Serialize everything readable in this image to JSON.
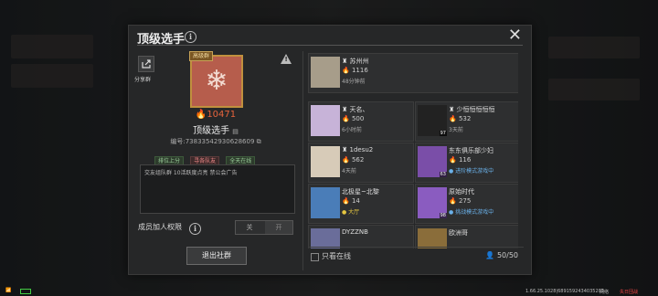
{
  "dialog": {
    "title": "顶级选手",
    "share_label": "分享群",
    "group_tag": "高级群",
    "power": "10471",
    "group_name": "顶级选手",
    "group_id": "编号:73833542930628609",
    "chips": [
      "排位上分",
      "寻各队友",
      "全天在线"
    ],
    "description": "交友组队群 10活跃度点亮 禁公会广告",
    "permission_label": "成员加人权限",
    "toggle_off": "关",
    "toggle_on": "开",
    "exit_label": "退出社群",
    "online_only_label": "只看在线",
    "member_count": "50/50"
  },
  "members": [
    {
      "name": "苏州州",
      "power": "1116",
      "status": "48分钟前",
      "status_color": "grey",
      "avatar_color": "#a79d8a"
    },
    {
      "name": "天名、",
      "power": "500",
      "status": "6小时前",
      "status_color": "grey",
      "avatar_color": "#c7b3d8"
    },
    {
      "name": "少恒恒恒恒恒",
      "power": "532",
      "status": "3天前",
      "status_color": "grey",
      "avatar_color": "#222222",
      "level": "97"
    },
    {
      "name": "1desu2",
      "power": "562",
      "status": "4天前",
      "status_color": "grey",
      "avatar_color": "#d7cbb8"
    },
    {
      "name": "东东俱乐部少妇",
      "power": "116",
      "status": "进阶模式游戏中",
      "status_color": "blue",
      "avatar_color": "#7a4ea8",
      "level": "63"
    },
    {
      "name": "北极星~北黎",
      "power": "14",
      "status": "大厅",
      "status_color": "yellow",
      "avatar_color": "#4a7db8"
    },
    {
      "name": "原始时代",
      "power": "275",
      "status": "挑战模式游戏中",
      "status_color": "blue",
      "avatar_color": "#8a5cc0",
      "level": "98"
    },
    {
      "name": "DYZZNB",
      "power": "",
      "status": "",
      "status_color": "grey",
      "avatar_color": "#6a6d9a"
    },
    {
      "name": "欧洲哥",
      "power": "",
      "status": "",
      "status_color": "grey",
      "avatar_color": "#8a6d3a"
    }
  ],
  "statusbar": {
    "left_text": "",
    "right_text": "1.66.25.1028|6891592434035203",
    "right_label": "网络",
    "brand": "失日団战"
  },
  "icons": {
    "close": "close-icon",
    "info": "info-icon",
    "share": "share-icon",
    "warning": "warning-icon",
    "flame": "flame-icon",
    "snowflake": "snowflake-icon"
  }
}
